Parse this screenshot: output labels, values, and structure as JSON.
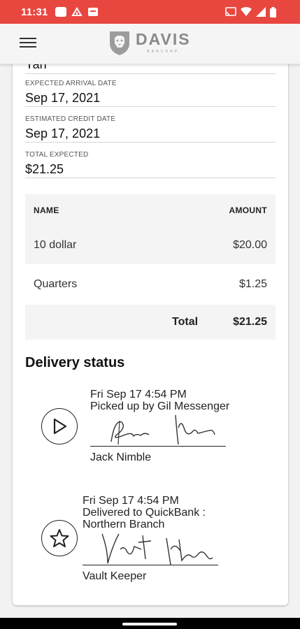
{
  "status_bar": {
    "time": "11:31"
  },
  "app": {
    "logo_name": "DAVIS",
    "logo_sub": "BANCORP"
  },
  "form": {
    "top_value": "Yan",
    "fields": [
      {
        "label": "EXPECTED ARRIVAL DATE",
        "value": "Sep 17, 2021"
      },
      {
        "label": "ESTIMATED CREDIT DATE",
        "value": "Sep 17, 2021"
      },
      {
        "label": "TOTAL EXPECTED",
        "value": "$21.25"
      }
    ]
  },
  "table": {
    "headers": {
      "name": "NAME",
      "amount": "AMOUNT"
    },
    "rows": [
      {
        "name": "10 dollar",
        "amount": "$20.00"
      },
      {
        "name": "Quarters",
        "amount": "$1.25"
      }
    ],
    "total_label": "Total",
    "total_value": "$21.25"
  },
  "delivery": {
    "title": "Delivery status",
    "events": [
      {
        "icon": "play-icon",
        "datetime": "Fri Sep 17 4:54 PM",
        "desc_line1": "Picked up by Gil Messenger",
        "desc_line2": "",
        "signer": "Jack Nimble"
      },
      {
        "icon": "star-icon",
        "datetime": "Fri Sep 17 4:54 PM",
        "desc_line1": "Delivered to QuickBank :",
        "desc_line2": "Northern Branch",
        "signer": "Vault Keeper"
      }
    ]
  }
}
